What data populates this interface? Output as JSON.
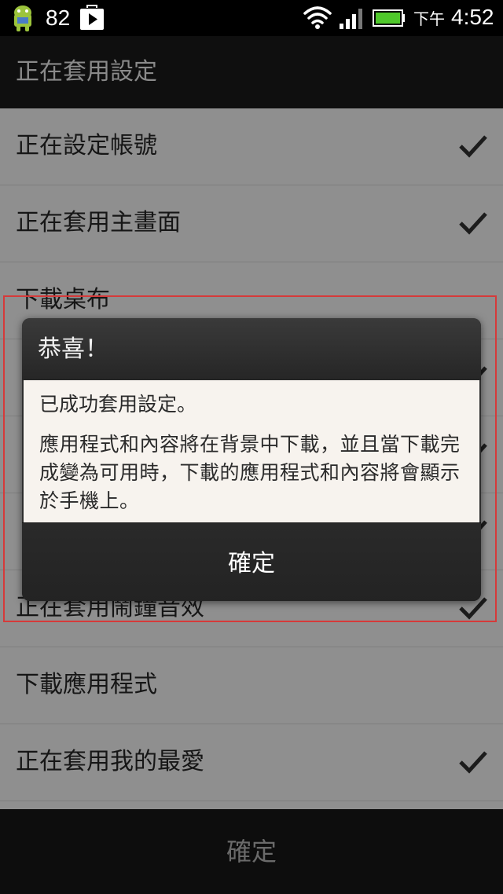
{
  "status_bar": {
    "notification_count": "82",
    "ampm": "下午",
    "time": "4:52",
    "icons": [
      "android-icon",
      "play-store-icon",
      "wifi-icon",
      "signal-icon",
      "battery-icon"
    ]
  },
  "title_bar": {
    "title": "正在套用設定"
  },
  "list": {
    "items": [
      {
        "label": "正在設定帳號",
        "checked": true
      },
      {
        "label": "正在套用主畫面",
        "checked": true
      },
      {
        "label": "下載桌布",
        "checked": false
      },
      {
        "label": "",
        "checked": true
      },
      {
        "label": "",
        "checked": true
      },
      {
        "label": "",
        "checked": true
      },
      {
        "label": "正在套用鬧鐘音效",
        "checked": true
      },
      {
        "label": "下載應用程式",
        "checked": false
      },
      {
        "label": "正在套用我的最愛",
        "checked": true
      }
    ]
  },
  "bottom_bar": {
    "ok_label": "確定"
  },
  "dialog": {
    "title": "恭喜！",
    "message": "已成功套用設定。",
    "detail": "應用程式和內容將在背景中下載，並且當下載完成變為可用時，下載的應用程式和內容將會顯示於手機上。",
    "ok_label": "確定"
  },
  "colors": {
    "dialog_body": "#f7f3ee",
    "highlight_outline": "#d63a3a"
  }
}
